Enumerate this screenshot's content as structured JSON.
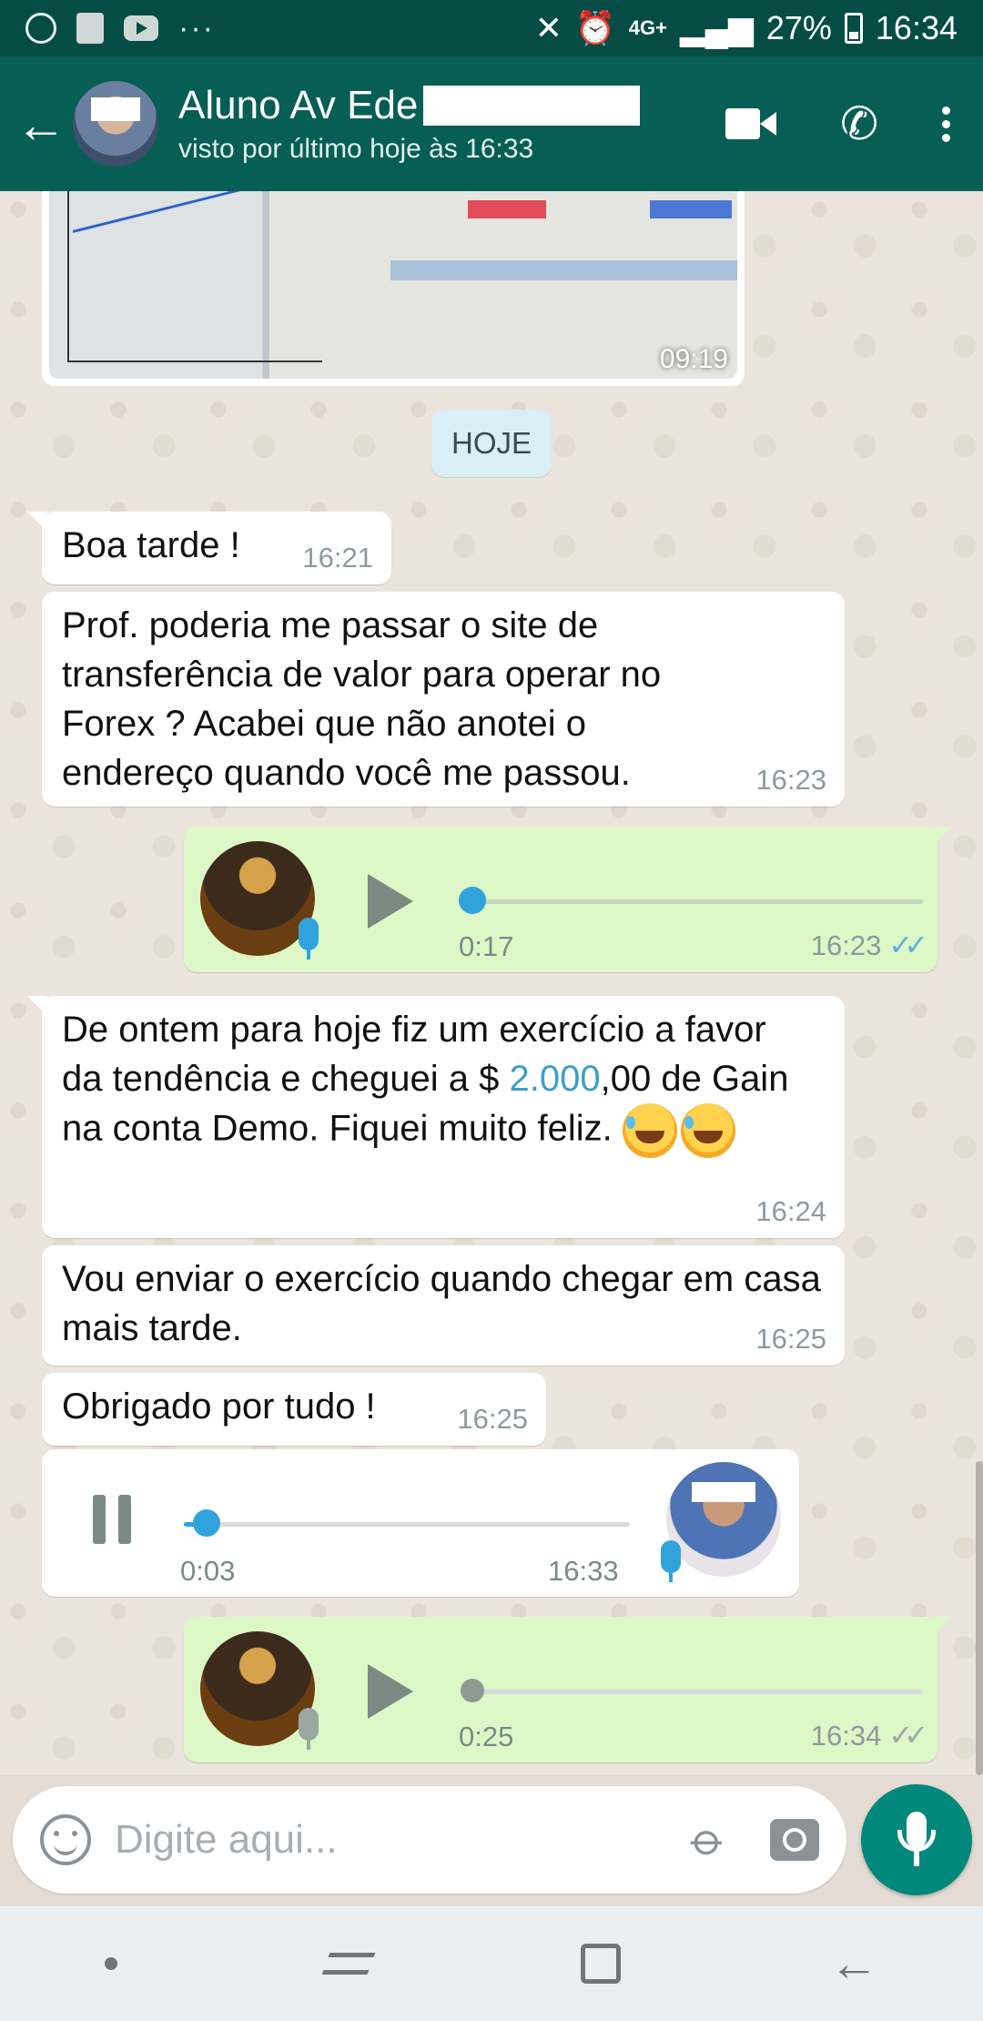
{
  "status_bar": {
    "network": "4G+",
    "battery": "27%",
    "time": "16:34"
  },
  "header": {
    "contact_name": "Aluno Av Ede",
    "last_seen": "visto por último hoje às 16:33"
  },
  "chat": {
    "image_message": {
      "time": "09:19"
    },
    "date_divider": "HOJE",
    "messages": [
      {
        "text": "Boa tarde !",
        "time": "16:21"
      },
      {
        "text": "Prof. poderia me passar o site de transferência de valor para operar no Forex ? Acabei que não anotei o endereço quando você me passou.",
        "time": "16:23"
      },
      {
        "voice_duration": "0:17",
        "time": "16:23",
        "played_progress": 0
      },
      {
        "text_before_link": "De ontem para hoje fiz um exercício a favor da tendência e cheguei a $ ",
        "link": "2.000",
        "text_after_link": ",00 de Gain na conta Demo. Fiquei muito feliz.",
        "time": "16:24"
      },
      {
        "text": "Vou enviar o exercício quando chegar em casa mais tarde.",
        "time": "16:25"
      },
      {
        "text": "Obrigado por tudo !",
        "time": "16:25"
      },
      {
        "voice_position": "0:03",
        "time": "16:33",
        "played_progress": 0.06
      },
      {
        "voice_duration": "0:25",
        "time": "16:34",
        "played_progress": 0
      }
    ]
  },
  "composer": {
    "placeholder": "Digite aqui..."
  },
  "colors": {
    "header": "#075e54",
    "outgoing_bubble": "#dcf8c6",
    "accent": "#00897b",
    "link": "#3b9fc8"
  }
}
